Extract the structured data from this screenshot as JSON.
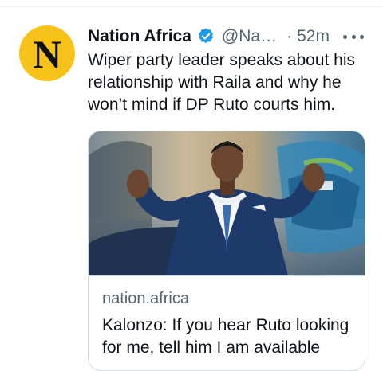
{
  "tweet": {
    "author_name": "Nation Africa",
    "avatar_letter": "N",
    "handle": "@Na…",
    "separator": "·",
    "time": "52m",
    "verified": true,
    "text": "Wiper party leader speaks about his relationship with Raila and why he won’t mind if DP Ruto courts him."
  },
  "card": {
    "domain": "nation.africa",
    "title": "Kalonzo: If you hear Ruto looking for me, tell him I am available"
  },
  "colors": {
    "verified_blue": "#1d9bf0",
    "avatar_yellow": "#f7c21a",
    "secondary_text": "#536471"
  },
  "icons": {
    "verified": "verified-badge-icon",
    "more": "more-horizontal-icon"
  }
}
